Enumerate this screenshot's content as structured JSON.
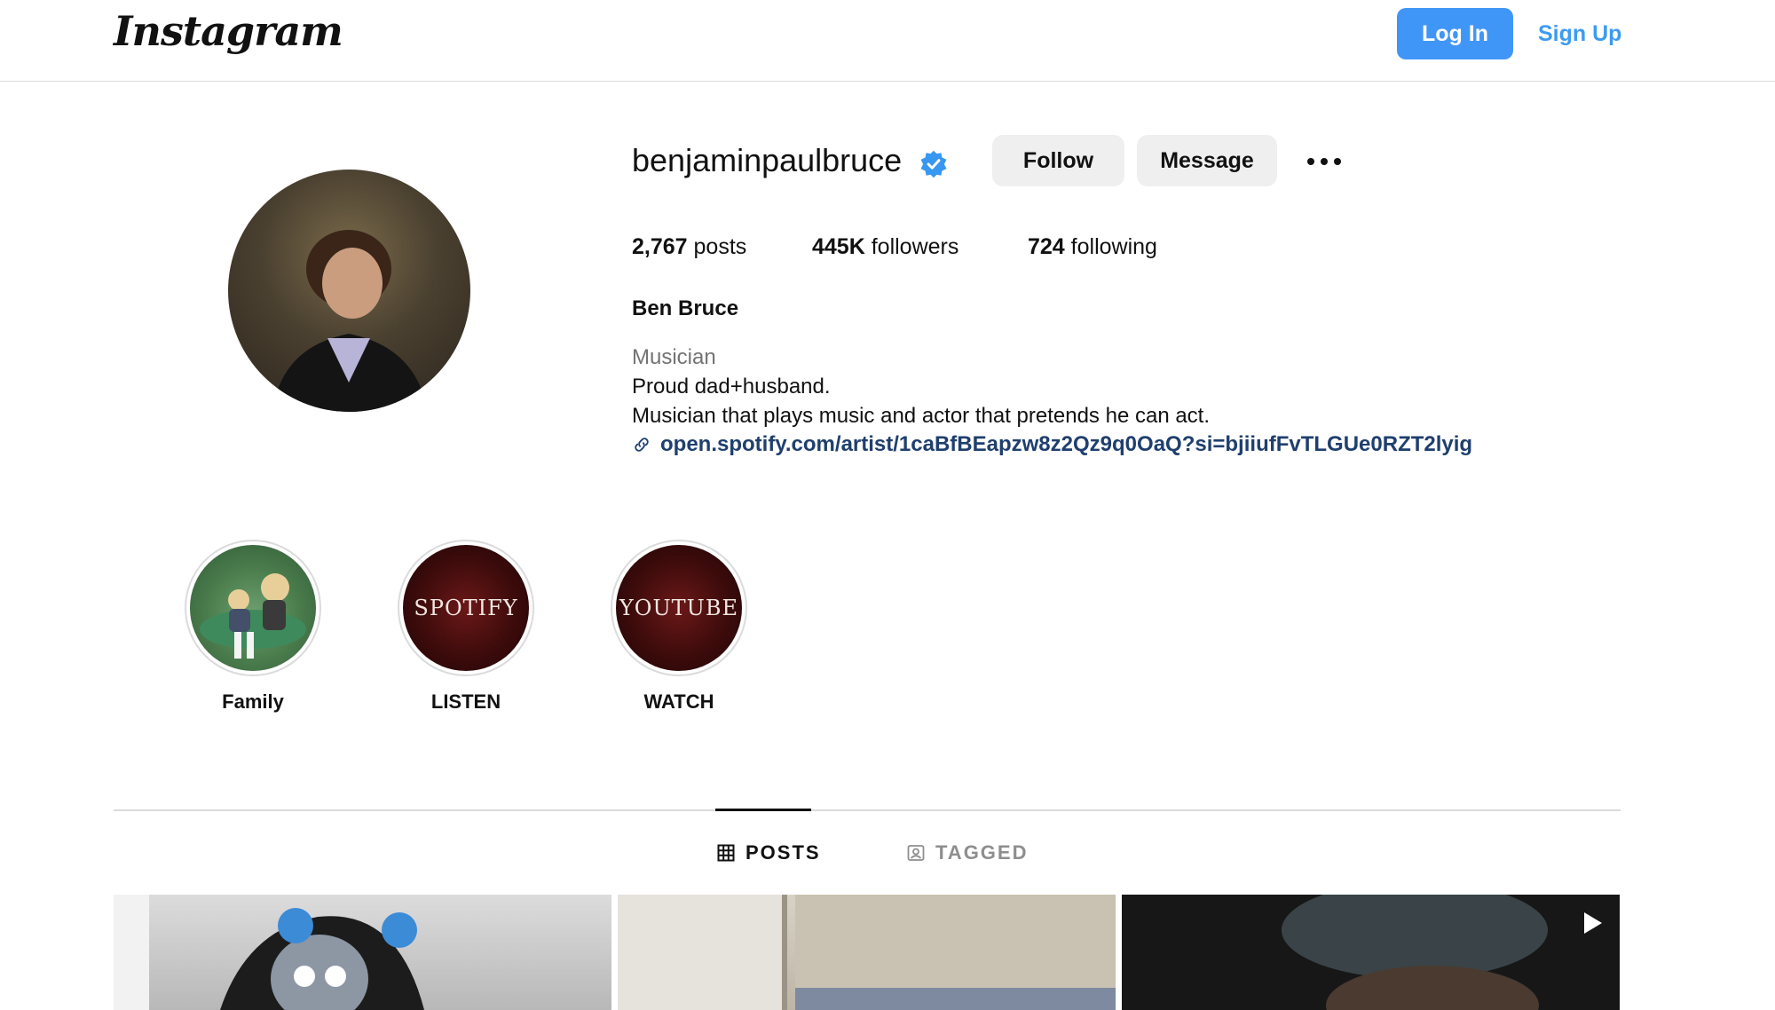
{
  "header": {
    "logo": "Instagram",
    "login_label": "Log In",
    "signup_label": "Sign Up"
  },
  "profile": {
    "username": "benjaminpaulbruce",
    "follow_label": "Follow",
    "message_label": "Message",
    "stats": {
      "posts_count": "2,767",
      "posts_label": "posts",
      "followers_count": "445K",
      "followers_label": "followers",
      "following_count": "724",
      "following_label": "following"
    },
    "full_name": "Ben Bruce",
    "category": "Musician",
    "bio_line1": "Proud dad+husband.",
    "bio_line2": "Musician that plays music and actor that pretends he can act.",
    "link": "open.spotify.com/artist/1caBfBEapzw8z2Qz9q0OaQ?si=bjiiufFvTLGUe0RZT2lyig"
  },
  "highlights": [
    {
      "label": "Family",
      "cover_text": ""
    },
    {
      "label": "LISTEN",
      "cover_text": "SPOTIFY"
    },
    {
      "label": "WATCH",
      "cover_text": "YOUTUBE"
    }
  ],
  "tabs": {
    "posts_label": "POSTS",
    "tagged_label": "TAGGED"
  },
  "colors": {
    "accent": "#4096f7",
    "link": "#1f3f6e",
    "verified": "#3897f0"
  }
}
